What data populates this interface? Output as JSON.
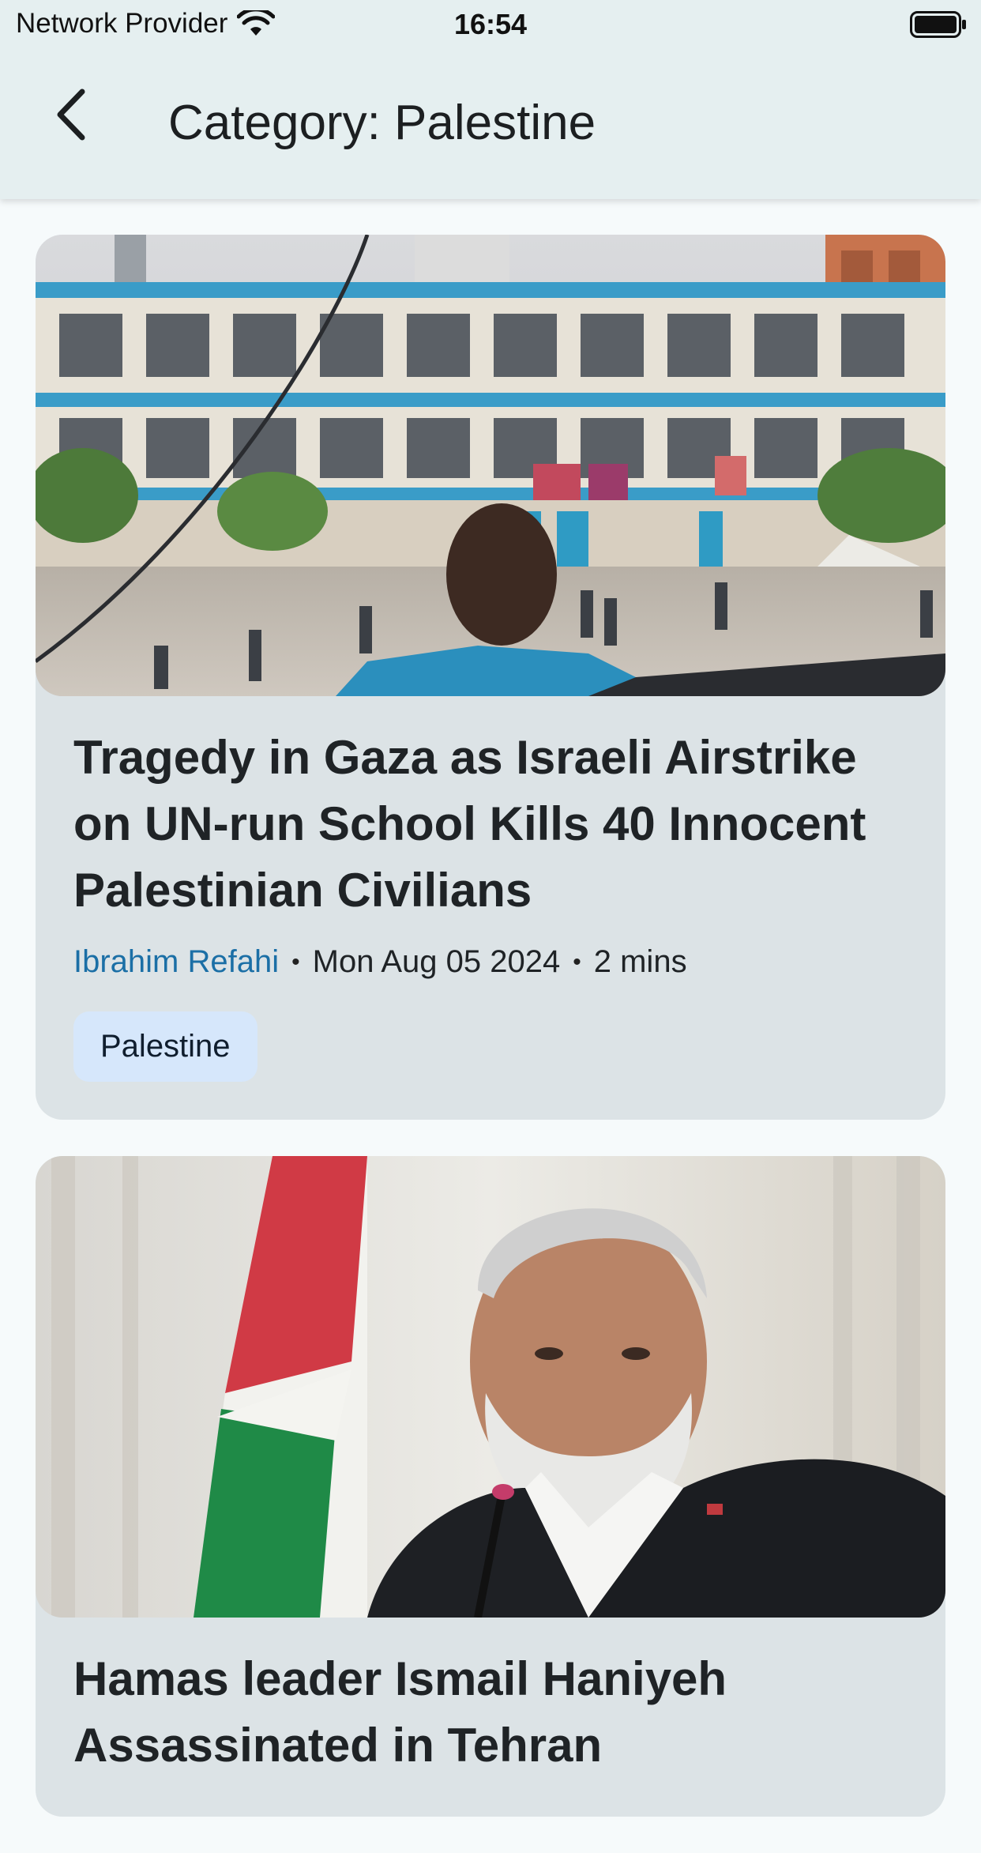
{
  "status_bar": {
    "carrier": "Network Provider",
    "time": "16:54"
  },
  "app_bar": {
    "title": "Category: Palestine"
  },
  "articles": [
    {
      "title": "Tragedy in Gaza as Israeli Airstrike on UN-run School Kills 40 Innocent Palestinian Civilians",
      "author": "Ibrahim Refahi",
      "separator": "•",
      "date": "Mon Aug 05 2024",
      "read_time": "2 mins",
      "category": "Palestine"
    },
    {
      "title": "Hamas leader Ismail Haniyeh Assassinated in Tehran"
    }
  ],
  "colors": {
    "accent_author": "#1b6fa6",
    "chip_bg": "#d6e7fb",
    "card_bg": "#dce3e6",
    "app_bar_bg": "#e5eff0"
  }
}
